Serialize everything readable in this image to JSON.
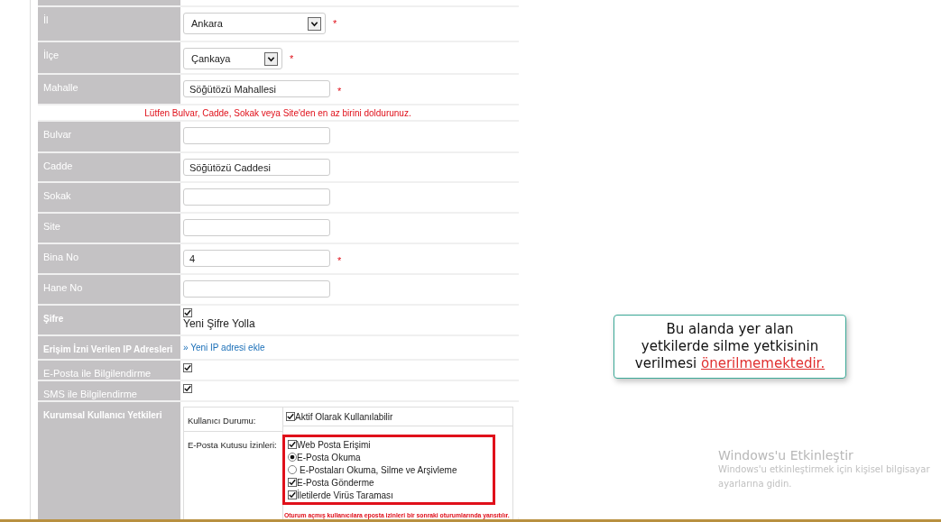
{
  "form_rows": [
    {
      "kind": "select",
      "label": "İl",
      "bold": false,
      "value": "Ankara",
      "required_mark": "*",
      "wide": true
    },
    {
      "kind": "select",
      "label": "İlçe",
      "bold": false,
      "value": "Çankaya",
      "required_mark": "*",
      "wide": false
    },
    {
      "kind": "text",
      "label": "Mahalle",
      "bold": false,
      "value": "Söğütözü Mahallesi",
      "required_mark": "*"
    },
    {
      "kind": "notice",
      "text": "Lütfen Bulvar, Cadde, Sokak veya Site'den en az birini doldurunuz."
    },
    {
      "kind": "text",
      "label": "Bulvar",
      "bold": false
    },
    {
      "kind": "text",
      "label": "Cadde",
      "bold": false,
      "value": "Söğütözü Caddesi"
    },
    {
      "kind": "text",
      "label": "Sokak",
      "bold": false
    },
    {
      "kind": "text",
      "label": "Site",
      "bold": false
    },
    {
      "kind": "text",
      "label": "Bina No",
      "bold": false,
      "value": "4",
      "required_mark": "*"
    },
    {
      "kind": "text",
      "label": "Hane No",
      "bold": false
    },
    {
      "kind": "checkbox",
      "label": "Şifre",
      "bold": true,
      "checked": true,
      "caption": "Yeni Şifre Yolla"
    },
    {
      "kind": "link",
      "label": "Erişim İzni Verilen IP Adresleri",
      "bold": true,
      "link": "» Yeni IP adresi ekle"
    },
    {
      "kind": "checkbox",
      "label": "E-Posta ile Bilgilendirme",
      "bold": false,
      "checked": true
    },
    {
      "kind": "checkbox",
      "label": "SMS ile Bilgilendirme",
      "bold": false,
      "checked": true
    },
    {
      "kind": "permissions",
      "label": "Kurumsal Kullanıcı Yetkileri",
      "bold": true,
      "status_label": "Kullanıcı Durumu:",
      "status": {
        "label": "Aktif Olarak Kullanılabilir",
        "checked": true
      },
      "mailbox_label": "E-Posta Kutusu İzinleri:",
      "highlighted": true,
      "options": [
        {
          "kind": "checkbox",
          "label": "Web Posta Erişimi",
          "checked": true
        },
        {
          "kind": "radio",
          "label": "E-Posta Okuma",
          "selected": true
        },
        {
          "kind": "radio",
          "label": "E-Postaları Okuma, Silme ve Arşivleme",
          "selected": false
        },
        {
          "kind": "checkbox",
          "label": "E-Posta Gönderme",
          "checked": true
        },
        {
          "kind": "checkbox",
          "label": "İletilerde Virüs Taraması",
          "checked": true
        }
      ],
      "note": "Oturum açmış kullanıcılara eposta izinleri bir sonraki oturumlarında yansıtılır."
    }
  ],
  "callout": {
    "text": "Bu alanda yer alan yetkilerde silme yetkisinin verilmesi",
    "emphasis": "önerilmemektedir."
  },
  "activation": {
    "title": "Windows'u Etkinleştir",
    "message": "Windows'u etkinleştirmek için kişisel bilgisayar ayarlarına gidin."
  }
}
